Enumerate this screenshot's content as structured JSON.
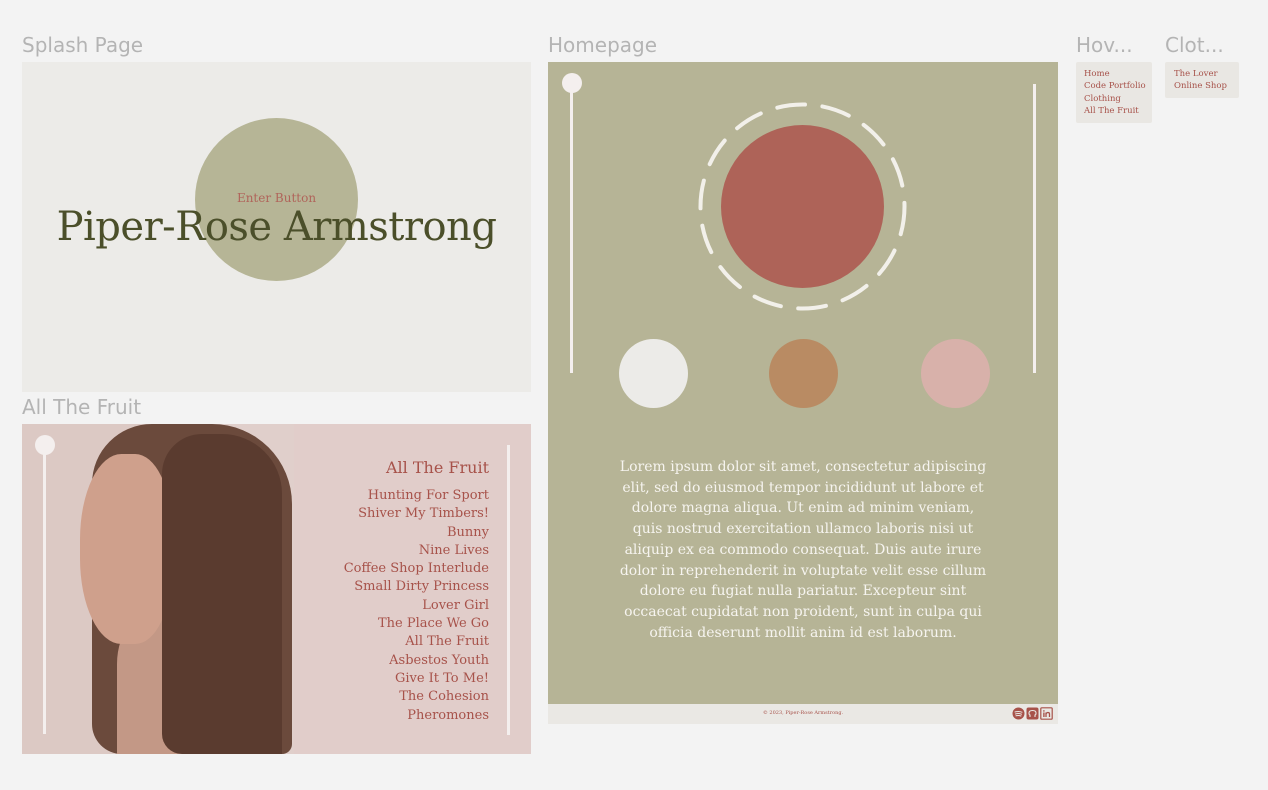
{
  "frames": {
    "splash": "Splash Page",
    "homepage": "Homepage",
    "hover": "Hov...",
    "clothing": "Clot...",
    "fruit": "All The Fruit"
  },
  "splash": {
    "enter_button": "Enter Button",
    "name": "Piper-Rose Armstrong"
  },
  "fruit": {
    "title": "All The Fruit",
    "tracks": [
      "Hunting For Sport",
      "Shiver My Timbers!",
      "Bunny",
      "Nine Lives",
      "Coffee Shop Interlude",
      "Small Dirty Princess",
      "Lover Girl",
      "The Place We Go",
      "All The Fruit",
      "Asbestos Youth",
      "Give It To Me!",
      "The Cohesion",
      "Pheromones"
    ]
  },
  "homepage": {
    "lorem": "Lorem ipsum dolor sit amet, consectetur adipiscing elit, sed do eiusmod tempor incididunt ut labore et dolore magna aliqua. Ut enim ad minim veniam, quis nostrud exercitation ullamco laboris nisi ut aliquip ex ea commodo consequat. Duis aute irure dolor in reprehenderit in voluptate velit esse cillum dolore eu fugiat nulla pariatur. Excepteur sint occaecat cupidatat non proident, sunt in culpa qui officia deserunt mollit anim id est laborum.",
    "copyright": "© 2023, Piper-Rose Armstrong.",
    "social_icons": [
      "spotify-icon",
      "github-icon",
      "linkedin-icon"
    ]
  },
  "hover_menu": [
    "Home",
    "Code Portfolio",
    "Clothing",
    "All The Fruit"
  ],
  "clothing_menu": [
    "The Lover",
    "Online Shop"
  ],
  "colors": {
    "olive": "#b6b496",
    "terracotta": "#ae6358",
    "dark_olive": "#4b4f2a",
    "accent_text": "#a7524a",
    "blush": "#e1cdca",
    "cream": "#ecebe8",
    "dot_white": "#ecebe8",
    "dot_ochre": "#b98b63",
    "dot_pink": "#d8b1aa"
  }
}
